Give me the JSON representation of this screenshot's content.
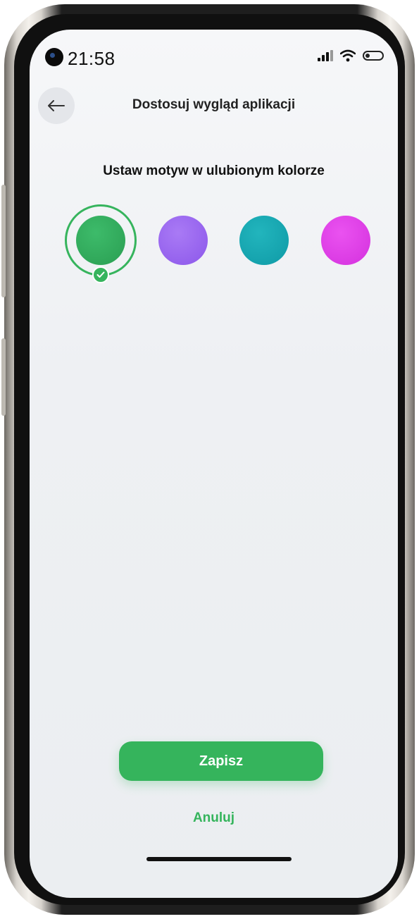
{
  "status_bar": {
    "time": "21:58",
    "icons": [
      "signal-icon",
      "wifi-icon",
      "battery-icon"
    ]
  },
  "header": {
    "back_icon": "arrow-left-icon",
    "title": "Dostosuj wygląd aplikacji"
  },
  "theme_picker": {
    "heading": "Ustaw motyw w ulubionym kolorze",
    "selected_index": 0,
    "swatches": [
      {
        "color": "#2fa85a",
        "selected": true
      },
      {
        "color": "#9a66ef",
        "selected": false
      },
      {
        "color": "#15a6b0",
        "selected": false
      },
      {
        "color": "#e03ee8",
        "selected": false
      }
    ]
  },
  "actions": {
    "save_label": "Zapisz",
    "cancel_label": "Anuluj"
  },
  "colors": {
    "accent": "#35b45c"
  }
}
